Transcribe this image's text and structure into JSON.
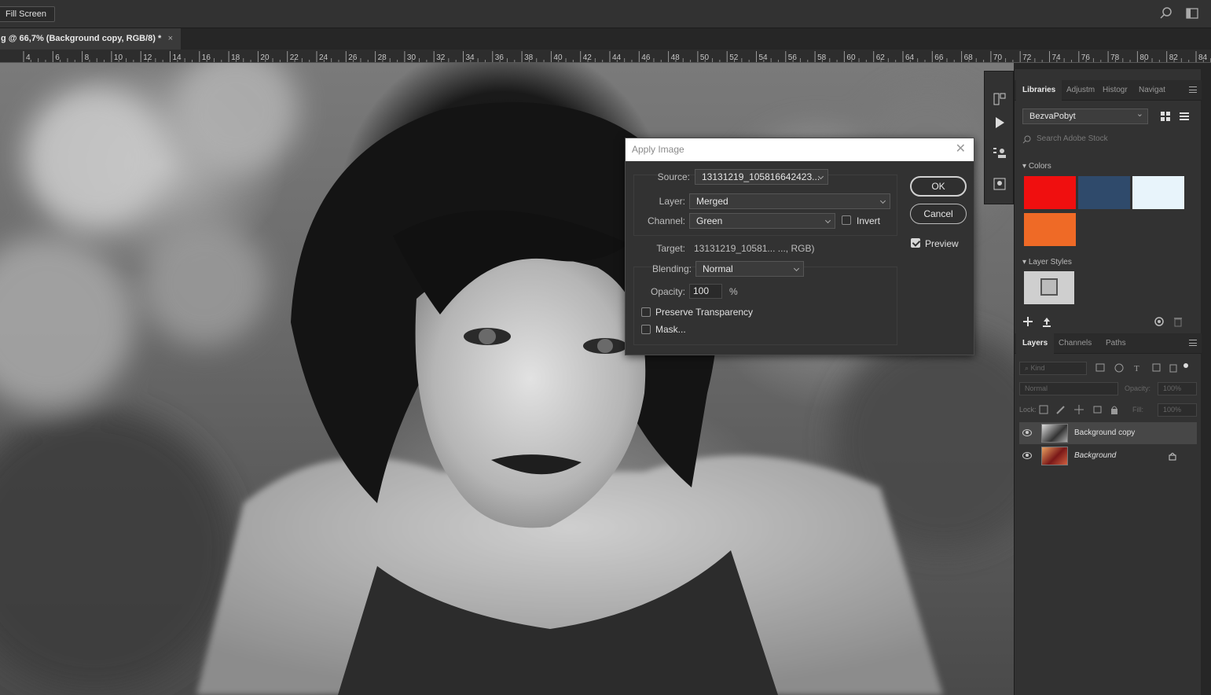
{
  "topbar": {
    "fill_screen": "Fill Screen"
  },
  "document": {
    "tab_title": "g @ 66,7% (Background copy, RGB/8) *",
    "close": "×"
  },
  "ruler": {
    "labels": [
      "4",
      "6",
      "8",
      "10",
      "12",
      "14",
      "16",
      "18",
      "20",
      "22",
      "24",
      "26",
      "28",
      "30",
      "32",
      "34",
      "36",
      "38",
      "40",
      "42",
      "44",
      "46",
      "48",
      "50",
      "52",
      "54",
      "56",
      "58",
      "60",
      "62",
      "64",
      "66",
      "68",
      "70",
      "72",
      "74",
      "76",
      "78",
      "80",
      "82",
      "84"
    ]
  },
  "libraries_panel": {
    "tabs": [
      "Libraries",
      "Adjustm",
      "Histogr",
      "Navigat"
    ],
    "library_name": "BezvaPobyt",
    "search_placeholder": "Search Adobe Stock",
    "colors_header": "Colors",
    "colors": [
      "#f00f0f",
      "#2f4a6b",
      "#e8f4fb",
      "#ef6a26"
    ],
    "layer_styles_header": "Layer Styles"
  },
  "layers_panel": {
    "tabs": [
      "Layers",
      "Channels",
      "Paths"
    ],
    "filter_kind": "Kind",
    "blend_mode": "Normal",
    "opacity_label": "Opacity:",
    "opacity_value": "100%",
    "lock_label": "Lock:",
    "fill_label": "Fill:",
    "fill_value": "100%",
    "layers": [
      {
        "name": "Background copy",
        "selected": true
      },
      {
        "name": "Background",
        "selected": false,
        "locked": true
      }
    ]
  },
  "apply_image_dialog": {
    "title": "Apply Image",
    "source_label": "Source:",
    "source_value": "13131219_105816642423...",
    "layer_label": "Layer:",
    "layer_value": "Merged",
    "channel_label": "Channel:",
    "channel_value": "Green",
    "invert_label": "Invert",
    "invert_checked": false,
    "target_label": "Target:",
    "target_value": "13131219_10581... ..., RGB)",
    "blending_label": "Blending:",
    "blending_value": "Normal",
    "opacity_label": "Opacity:",
    "opacity_value": "100",
    "percent": "%",
    "preserve_transparency_label": "Preserve Transparency",
    "preserve_transparency_checked": false,
    "mask_label": "Mask...",
    "mask_checked": false,
    "ok_label": "OK",
    "cancel_label": "Cancel",
    "preview_label": "Preview",
    "preview_checked": true
  }
}
